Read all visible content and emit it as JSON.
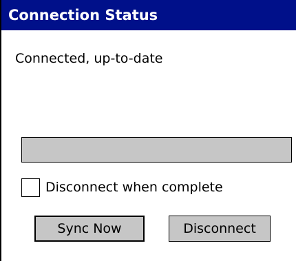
{
  "window": {
    "title": "Connection Status"
  },
  "status": {
    "text": "Connected, up-to-date"
  },
  "progress": {
    "value": 0
  },
  "options": {
    "disconnect_when_complete_label": "Disconnect when complete",
    "disconnect_when_complete_checked": false
  },
  "buttons": {
    "sync_now_label": "Sync Now",
    "disconnect_label": "Disconnect"
  },
  "colors": {
    "title_bar": "#00108a",
    "button_face": "#c6c6c6",
    "progress_track": "#c6c6c6"
  }
}
